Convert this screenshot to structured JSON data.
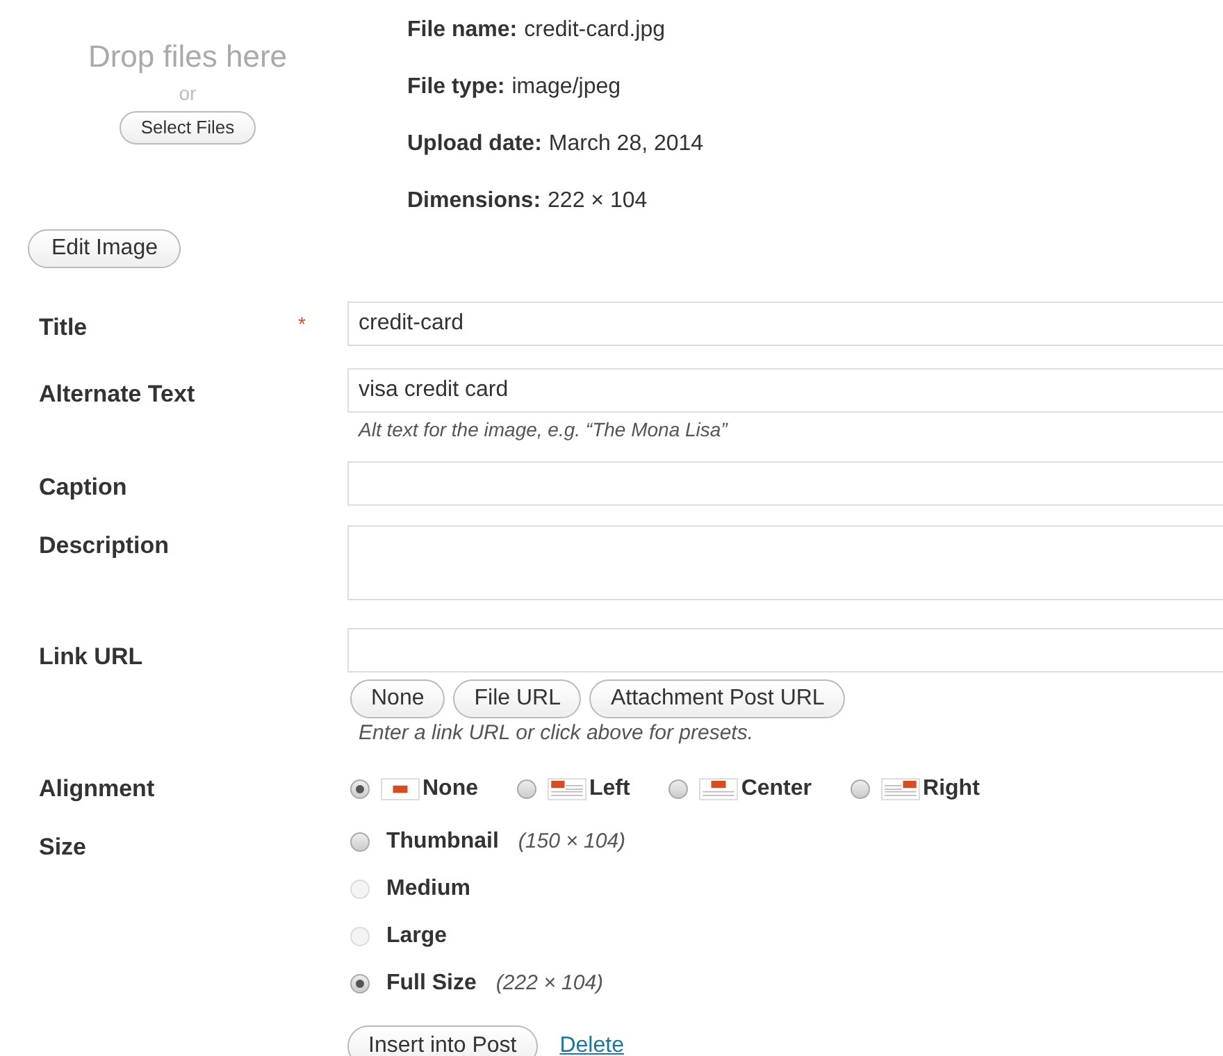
{
  "uploader": {
    "drop_text": "Drop files here",
    "or_text": "or",
    "select_button": "Select Files"
  },
  "file_info": [
    {
      "label": "File name:",
      "value": "credit-card.jpg"
    },
    {
      "label": "File type:",
      "value": "image/jpeg"
    },
    {
      "label": "Upload date:",
      "value": "March 28, 2014"
    },
    {
      "label": "Dimensions:",
      "value": "222 × 104"
    }
  ],
  "edit_button": "Edit Image",
  "fields": [
    {
      "kind": "text",
      "label": "Title",
      "required_mark": "*",
      "value": "credit-card"
    },
    {
      "kind": "text",
      "label": "Alternate Text",
      "value": "visa credit card",
      "help": "Alt text for the image, e.g. “The Mona Lisa”"
    },
    {
      "kind": "text",
      "label": "Caption"
    },
    {
      "kind": "textarea",
      "label": "Description"
    }
  ],
  "link_url": {
    "label": "Link URL",
    "presets": [
      "None",
      "File URL",
      "Attachment Post URL"
    ],
    "help": "Enter a link URL or click above for presets."
  },
  "alignment": {
    "label": "Alignment",
    "options": [
      {
        "kind": "none",
        "label": "None",
        "selected": true
      },
      {
        "kind": "left",
        "label": "Left",
        "selected": false
      },
      {
        "kind": "center",
        "label": "Center",
        "selected": false
      },
      {
        "kind": "right",
        "label": "Right",
        "selected": false
      }
    ]
  },
  "size": {
    "label": "Size",
    "options": [
      {
        "label": "Thumbnail",
        "dims": "(150 × 104)",
        "selected": false,
        "disabled": false
      },
      {
        "label": "Medium",
        "selected": false,
        "disabled": true
      },
      {
        "label": "Large",
        "selected": false,
        "disabled": true
      },
      {
        "label": "Full Size",
        "dims": "(222 × 104)",
        "selected": true,
        "disabled": false
      }
    ]
  },
  "insert_button": "Insert into Post",
  "delete_link": "Delete"
}
